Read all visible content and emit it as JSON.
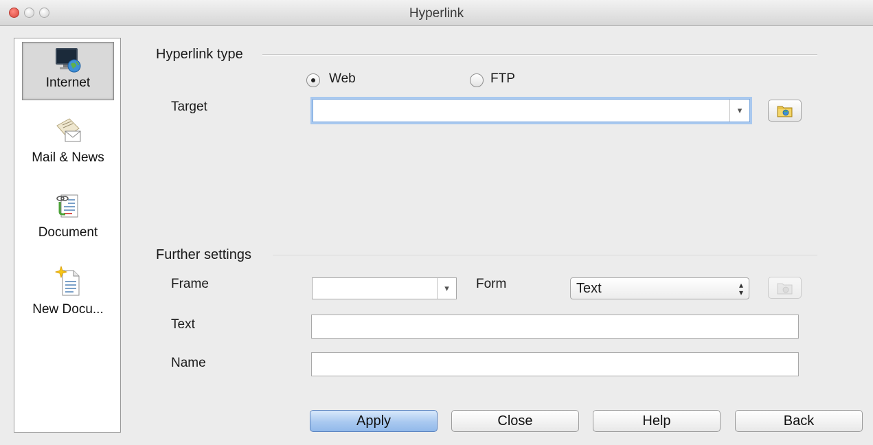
{
  "window": {
    "title": "Hyperlink"
  },
  "sidebar": {
    "items": [
      {
        "label": "Internet",
        "icon": "internet-globe-icon",
        "active": true
      },
      {
        "label": "Mail & News",
        "icon": "mail-envelope-icon",
        "active": false
      },
      {
        "label": "Document",
        "icon": "document-link-icon",
        "active": false
      },
      {
        "label": "New Docu...",
        "icon": "new-document-icon",
        "active": false
      }
    ]
  },
  "hyperlink_type": {
    "title": "Hyperlink type",
    "options": [
      {
        "label": "Web",
        "checked": true
      },
      {
        "label": "FTP",
        "checked": false
      }
    ],
    "target_label": "Target",
    "target_value": ""
  },
  "further_settings": {
    "title": "Further settings",
    "frame_label": "Frame",
    "frame_value": "",
    "form_label": "Form",
    "form_value": "Text",
    "text_label": "Text",
    "text_value": "",
    "name_label": "Name",
    "name_value": ""
  },
  "buttons": {
    "apply": "Apply",
    "close": "Close",
    "help": "Help",
    "back": "Back"
  },
  "colors": {
    "focus_ring": "#a8c8ef",
    "primary_button": "#a9c9f0"
  }
}
